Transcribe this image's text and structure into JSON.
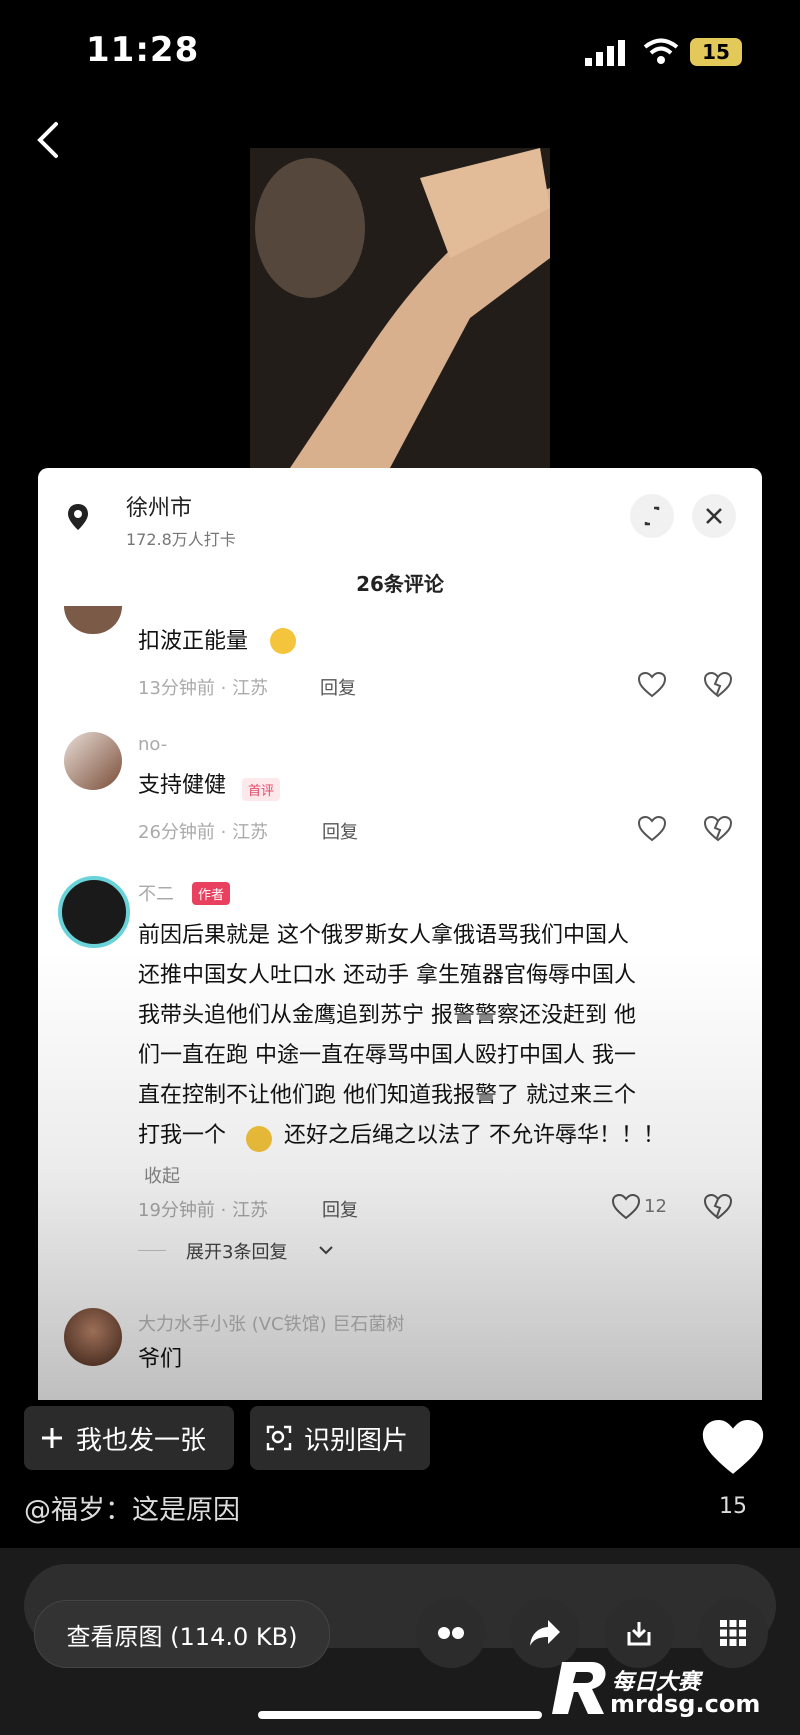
{
  "status_bar": {
    "time": "11:28",
    "battery": "15"
  },
  "location": {
    "city": "徐州市",
    "checkins": "172.8万人打卡"
  },
  "comments_header": "26条评论",
  "comments": [
    {
      "name": "",
      "text": "扣波正能量",
      "time_loc": "13分钟前 · 江苏",
      "reply": "回复",
      "likes": ""
    },
    {
      "name": "no-",
      "text": "支持健健",
      "badge": "首评",
      "time_loc": "26分钟前 · 江苏",
      "reply": "回复",
      "likes": ""
    },
    {
      "name": "不二",
      "badge": "作者",
      "lines": [
        "前因后果就是 这个俄罗斯女人拿俄语骂我们中国人",
        "还推中国女人吐口水 还动手 拿生殖器官侮辱中国人",
        "我带头追他们从金鹰追到苏宁 报警警察还没赶到 他",
        "们一直在跑 中途一直在辱骂中国人殴打中国人 我一",
        "直在控制不让他们跑 他们知道我报警了 就过来三个",
        "打我一个",
        "还好之后绳之以法了 不允许辱华！！！"
      ],
      "collapse": "收起",
      "time_loc": "19分钟前 · 江苏",
      "reply": "回复",
      "likes": "12",
      "expand": "展开3条回复"
    },
    {
      "name": "大力水手小张 (VC铁馆) 巨石菌树",
      "text": "爷们"
    }
  ],
  "actions": {
    "post": "我也发一张",
    "recognize": "识别图片"
  },
  "caption": "@福岁：这是原因",
  "like_count": "15",
  "view_original": "查看原图 (114.0 KB)",
  "watermark": {
    "top": "每日大赛",
    "bottom": "mrdsg.com"
  }
}
